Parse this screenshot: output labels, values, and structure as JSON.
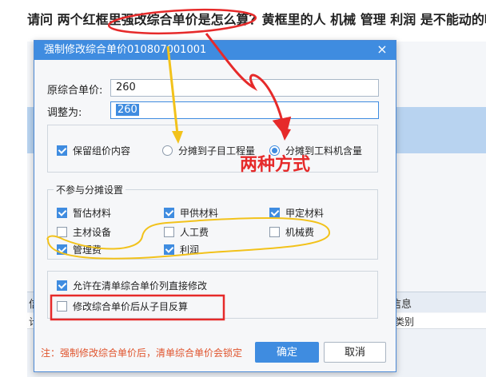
{
  "question": "请问 两个红框里强改综合单价是怎么算？黄框里的人 机械 管理 利润 是不能动的吗",
  "background": {
    "tab_left": "信",
    "tab_right": "信息",
    "row_left": "计",
    "row_right": "类别"
  },
  "dialog": {
    "title": "强制修改综合单价010807001001",
    "close_glyph": "×",
    "original_label": "原综合单价:",
    "original_value": "260",
    "adjust_label": "调整为:",
    "adjust_value": "260",
    "keep_group_label": "保留组价内容",
    "keep_group_checked": true,
    "radio_sub_label": "分摊到子目工程量",
    "radio_sub_selected": false,
    "radio_material_label": "分摊到工料机含量",
    "radio_material_selected": true,
    "exclude_title": "不参与分摊设置",
    "exclude_items": [
      {
        "label": "暂估材料",
        "checked": true
      },
      {
        "label": "甲供材料",
        "checked": true
      },
      {
        "label": "甲定材料",
        "checked": true
      },
      {
        "label": "主材设备",
        "checked": false
      },
      {
        "label": "人工费",
        "checked": false
      },
      {
        "label": "机械费",
        "checked": false
      },
      {
        "label": "管理费",
        "checked": true
      },
      {
        "label": "利润",
        "checked": true
      }
    ],
    "allow_edit_label": "允许在清单综合单价列直接修改",
    "allow_edit_checked": true,
    "reverse_label": "修改综合单价后从子目反算",
    "reverse_checked": false,
    "note": "注：强制修改综合单价后，清单综合单价会锁定",
    "ok_label": "确定",
    "cancel_label": "取消"
  },
  "annotations": {
    "two_methods_text": "两种方式",
    "red_color": "#e62a2a",
    "yellow_color": "#f2c21b"
  }
}
